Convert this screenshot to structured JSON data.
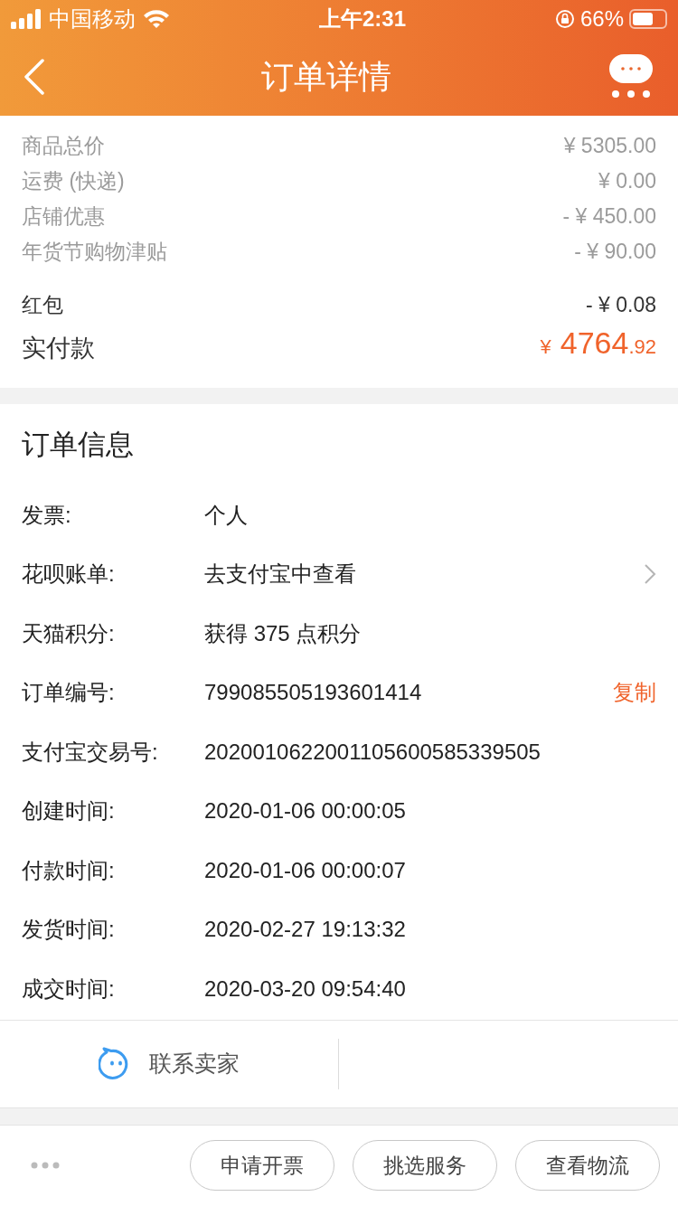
{
  "status_bar": {
    "carrier": "中国移动",
    "time": "上午2:31",
    "battery_text": "66%",
    "battery": {
      "level": 0.66
    }
  },
  "nav": {
    "title": "订单详情"
  },
  "price_rows": [
    {
      "label": "商品总价",
      "value": "¥ 5305.00",
      "kind": "muted"
    },
    {
      "label": "运费 (快递)",
      "value": "¥ 0.00",
      "kind": "muted"
    },
    {
      "label": "店铺优惠",
      "value": "- ¥ 450.00",
      "kind": "muted"
    },
    {
      "label": "年货节购物津贴",
      "value": "- ¥ 90.00",
      "kind": "muted"
    },
    {
      "label": "红包",
      "value": "- ¥ 0.08",
      "kind": "normal"
    }
  ],
  "total": {
    "label": "实付款",
    "currency": "¥",
    "integer": "4764",
    "decimal": ".92"
  },
  "order_info": {
    "title": "订单信息",
    "rows": [
      {
        "label": "发票:",
        "value": "个人",
        "kind": "plain"
      },
      {
        "label": "花呗账单:",
        "value": "去支付宝中查看",
        "kind": "link"
      },
      {
        "label": "天猫积分:",
        "value": "获得 375 点积分",
        "kind": "plain"
      },
      {
        "label": "订单编号:",
        "value": "799085505193601414",
        "kind": "copy",
        "action": "复制"
      },
      {
        "label": "支付宝交易号:",
        "value": "2020010622001105600585339505",
        "kind": "plain"
      },
      {
        "label": "创建时间:",
        "value": "2020-01-06 00:00:05",
        "kind": "plain"
      },
      {
        "label": "付款时间:",
        "value": "2020-01-06 00:00:07",
        "kind": "plain"
      },
      {
        "label": "发货时间:",
        "value": "2020-02-27 19:13:32",
        "kind": "plain"
      },
      {
        "label": "成交时间:",
        "value": "2020-03-20 09:54:40",
        "kind": "plain"
      }
    ]
  },
  "contact": {
    "label": "联系卖家"
  },
  "bottom_buttons": [
    "申请开票",
    "挑选服务",
    "查看物流"
  ]
}
